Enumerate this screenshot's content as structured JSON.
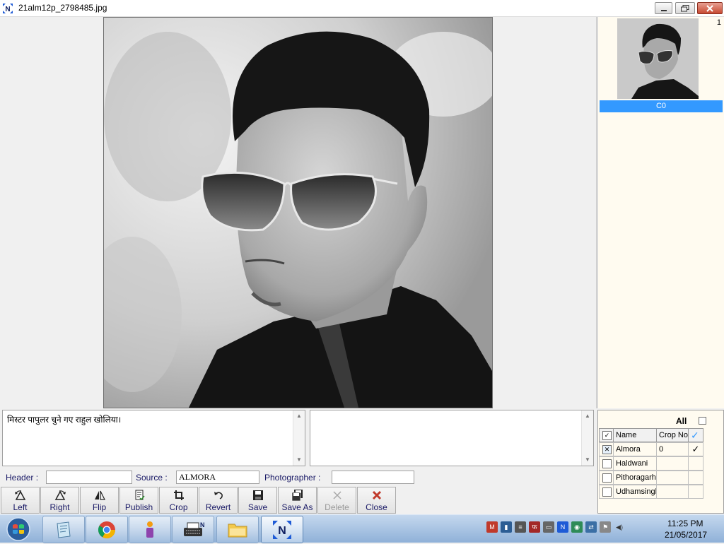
{
  "window": {
    "title": "21alm12p_2798485.jpg",
    "thumb_index": "1",
    "thumb_caption": "C0"
  },
  "caption": {
    "text": "मिस्टर पापुलर चुने गए राहुल खोलिया।",
    "notes": ""
  },
  "meta": {
    "header_label": "Header :",
    "header_value": "",
    "source_label": "Source :",
    "source_value": "ALMORA",
    "photographer_label": "Photographer :",
    "photographer_value": ""
  },
  "toolbar": {
    "left": "Left",
    "right": "Right",
    "flip": "Flip",
    "publish": "Publish",
    "crop": "Crop",
    "revert": "Revert",
    "save": "Save",
    "save_as": "Save As",
    "delete": "Delete",
    "close": "Close"
  },
  "districts": {
    "all_label": "All",
    "all_checked": false,
    "col_name": "Name",
    "col_crop": "Crop No",
    "rows": [
      {
        "name": "Almora",
        "crop": "0",
        "checked": true,
        "selected": true
      },
      {
        "name": "Haldwani",
        "crop": "",
        "checked": false,
        "selected": false
      },
      {
        "name": "Pithoragarh",
        "crop": "",
        "checked": false,
        "selected": false
      },
      {
        "name": "Udhamsingh",
        "crop": "",
        "checked": false,
        "selected": false
      }
    ]
  },
  "taskbar": {
    "time": "11:25 PM",
    "date": "21/05/2017",
    "apps": [
      "start-orb",
      "notepad-app",
      "chrome-app",
      "user-app",
      "typewriter-app",
      "file-explorer-app",
      "photo-app"
    ]
  },
  "colors": {
    "selection_blue": "#3399ff",
    "panel_cream": "#fffbf0",
    "close_red": "#c0392b"
  }
}
